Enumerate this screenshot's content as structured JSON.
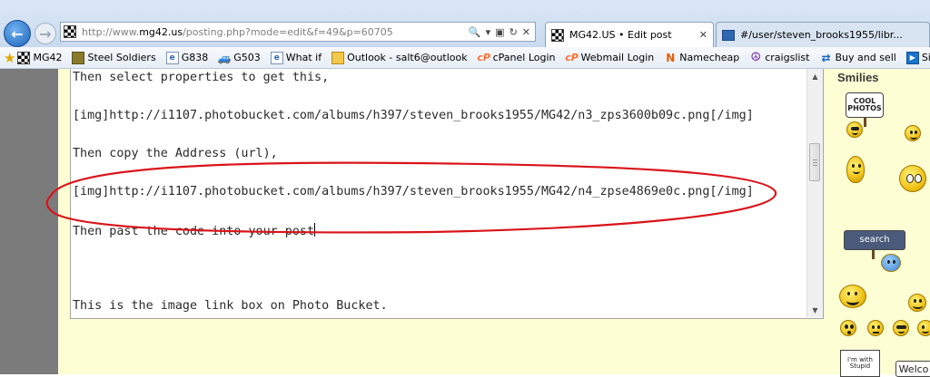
{
  "browser": {
    "url_prefix": "http://www.",
    "url_domain": "mg42.us",
    "url_path": "/posting.php?mode=edit&f=49&p=60705",
    "address_icons": [
      "🔍",
      "▾",
      "▣",
      "↻",
      "✕"
    ],
    "tabs": [
      {
        "title": "MG42.US • Edit post",
        "close": "✕",
        "active": true
      },
      {
        "title": "#/user/steven_brooks1955/libr...",
        "close": "",
        "active": false
      }
    ],
    "back_glyph": "←",
    "forward_glyph": "→"
  },
  "favorites": [
    {
      "label": "MG42",
      "icon": "mg42-favicon"
    },
    {
      "label": "Steel Soldiers",
      "icon": "steel-soldiers-icon"
    },
    {
      "label": "G838",
      "icon": "page-icon"
    },
    {
      "label": "G503",
      "icon": "jeep-icon"
    },
    {
      "label": "What if",
      "icon": "page-icon"
    },
    {
      "label": "Outlook - salt6@outlook",
      "icon": "outlook-icon"
    },
    {
      "label": "cPanel Login",
      "icon": "cpanel-icon"
    },
    {
      "label": "Webmail Login",
      "icon": "cpanel-icon"
    },
    {
      "label": "Namecheap",
      "icon": "namecheap-icon"
    },
    {
      "label": "craigslist",
      "icon": "peace-icon"
    },
    {
      "label": "Buy and sell",
      "icon": "buy-sell-icon"
    },
    {
      "label": "Sign In - DIRECTV",
      "icon": "directv-icon"
    }
  ],
  "favorites_star": "★",
  "editor": {
    "lines": [
      "Then select properties to get this,",
      "[img]http://i1107.photobucket.com/albums/h397/steven_brooks1955/MG42/n3_zps3600b09c.png[/img]",
      "Then copy the Address (url),",
      "[img]http://i1107.photobucket.com/albums/h397/steven_brooks1955/MG42/n4_zpse4869e0c.png[/img]",
      "Then past the code into your post",
      "This is the image link box on Photo Bucket."
    ],
    "scroll_up": "▲",
    "scroll_down": "▼",
    "annotation_color": "#d9141a"
  },
  "smilies": {
    "title": "Smilies",
    "signs": [
      "COOL PHOTOS",
      "search",
      "I'm with Stupid",
      "Welco"
    ]
  },
  "colors": {
    "page_background": "#fefed4",
    "left_strip": "#7b7b7b"
  }
}
